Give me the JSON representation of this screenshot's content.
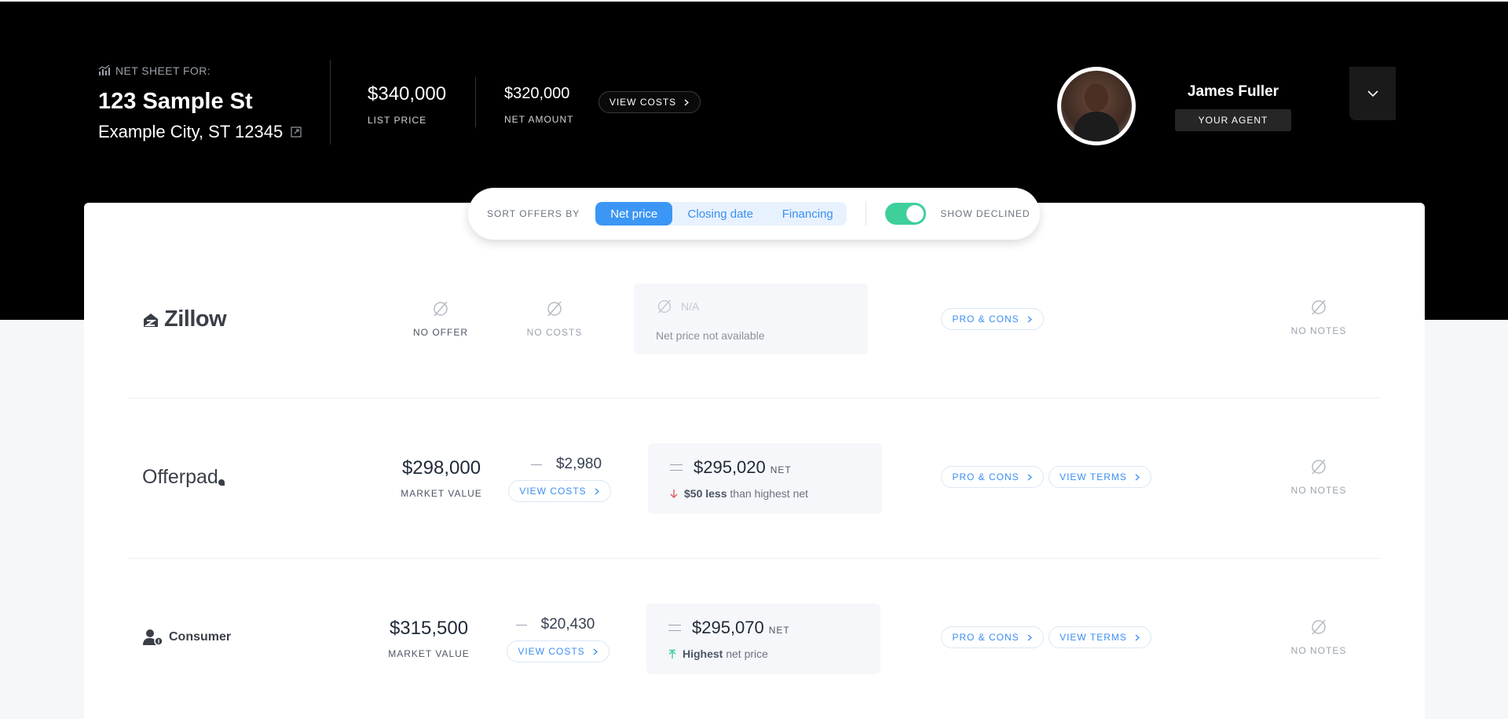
{
  "header": {
    "net_sheet_label": "NET SHEET FOR:",
    "address_line1": "123 Sample St",
    "address_line2": "Example City, ST 12345",
    "list_price": "$340,000",
    "list_price_label": "LIST PRICE",
    "net_amount": "$320,000",
    "net_amount_label": "NET AMOUNT",
    "view_costs_label": "VIEW COSTS",
    "agent_name": "James Fuller",
    "agent_badge": "YOUR AGENT"
  },
  "sortbar": {
    "label": "SORT OFFERS BY",
    "options": [
      "Net price",
      "Closing date",
      "Financing"
    ],
    "active": "Net price",
    "show_declined_label": "SHOW DECLINED",
    "show_declined": true
  },
  "offers": [
    {
      "company": "Zillow",
      "offer_label": "NO OFFER",
      "costs_label": "NO COSTS",
      "net_na": "N/A",
      "net_sub": "Net price not available",
      "pros_cons": "PRO & CONS",
      "notes": "NO NOTES"
    },
    {
      "company": "Offerpad",
      "market_value": "$298,000",
      "market_value_label": "MARKET VALUE",
      "costs": "$2,980",
      "view_costs": "VIEW COSTS",
      "net": "$295,020",
      "net_label": "NET",
      "net_diff_bold": "$50 less",
      "net_diff_rest": "than highest net",
      "pros_cons": "PRO & CONS",
      "view_terms": "VIEW TERMS",
      "notes": "NO NOTES"
    },
    {
      "company": "Consumer",
      "market_value": "$315,500",
      "market_value_label": "MARKET VALUE",
      "costs": "$20,430",
      "view_costs": "VIEW COSTS",
      "net": "$295,070",
      "net_label": "NET",
      "net_diff_bold": "Highest",
      "net_diff_rest": "net price",
      "pros_cons": "PRO & CONS",
      "view_terms": "VIEW TERMS",
      "notes": "NO NOTES"
    }
  ],
  "colors": {
    "accent": "#3c96f5",
    "toggle_on": "#3ecf9b",
    "down_arrow": "#e05a5a",
    "up_arrow": "#3ecf9b"
  },
  "icons": [
    "chart-icon",
    "external-link-icon",
    "chevron-right-icon",
    "chevron-down-icon",
    "null-icon",
    "equals-icon",
    "arrow-down-icon",
    "arrow-up-icon",
    "consumer-icon"
  ]
}
